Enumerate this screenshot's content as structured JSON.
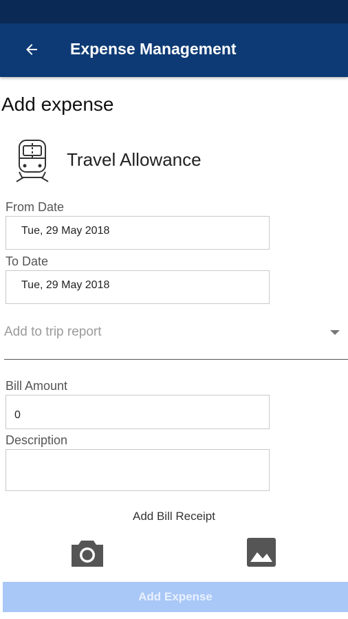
{
  "header": {
    "title": "Expense Management"
  },
  "page": {
    "title": "Add expense",
    "category": "Travel Allowance"
  },
  "form": {
    "from_date": {
      "label": "From Date",
      "value": "Tue, 29 May 2018"
    },
    "to_date": {
      "label": "To Date",
      "value": "Tue, 29 May 2018"
    },
    "trip_report": {
      "placeholder": "Add to trip report"
    },
    "bill_amount": {
      "label": "Bill Amount",
      "value": "0"
    },
    "description": {
      "label": "Description",
      "value": ""
    },
    "receipt_label": "Add Bill Receipt",
    "submit_label": "Add Expense"
  },
  "icons": {
    "back": "arrow-back-icon",
    "category": "train-icon",
    "camera": "camera-icon",
    "gallery": "image-gallery-icon"
  },
  "colors": {
    "appbar": "#0d3a74",
    "statusbar": "#0a2a55",
    "submit_disabled": "#a9c7f7"
  }
}
